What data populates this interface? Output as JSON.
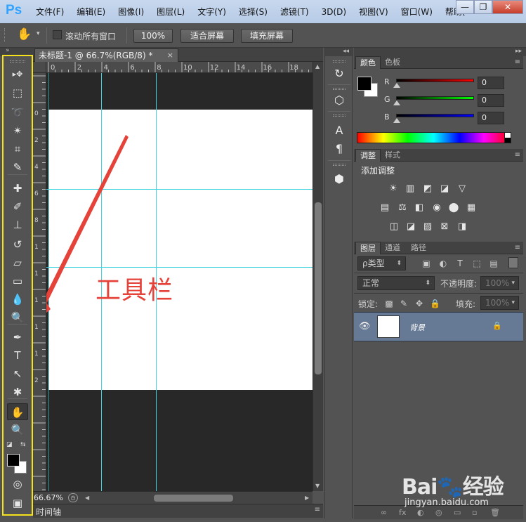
{
  "app": {
    "logo": "Ps",
    "menu": [
      "文件(F)",
      "编辑(E)",
      "图像(I)",
      "图层(L)",
      "文字(Y)",
      "选择(S)",
      "滤镜(T)",
      "3D(D)",
      "视图(V)",
      "窗口(W)",
      "帮助("
    ],
    "window_controls": {
      "minimize": "—",
      "restore": "❐",
      "close": "✕"
    }
  },
  "options_bar": {
    "tool_icon": "hand-icon",
    "scroll_all_label": "滚动所有窗口",
    "scroll_all_checked": false,
    "zoom_100_label": "100%",
    "fit_screen_label": "适合屏幕",
    "fill_screen_label": "填充屏幕"
  },
  "document": {
    "tab_title": "未标题-1 @ 66.7%(RGB/8) *",
    "tab_close": "×",
    "ruler_h_labels": [
      "0",
      "2",
      "4",
      "6",
      "8",
      "10",
      "12",
      "14",
      "16",
      "18"
    ],
    "ruler_v_labels": [
      "0",
      "2",
      "4",
      "6",
      "8",
      "1",
      "1",
      "1",
      "1",
      "1",
      "2"
    ],
    "annotation_text": "工具栏",
    "annotation_color": "#e5433a",
    "guide_color": "#3fd4e0",
    "zoom_readout": "66.67%",
    "timeline_label": "时间轴"
  },
  "toolbox": {
    "highlight_color": "#f5e21a",
    "tools": [
      {
        "name": "move-tool",
        "glyph": "▸✥"
      },
      {
        "name": "marquee-tool",
        "glyph": "⬚"
      },
      {
        "name": "lasso-tool",
        "glyph": "➰"
      },
      {
        "name": "magic-wand-tool",
        "glyph": "✴"
      },
      {
        "name": "crop-tool",
        "glyph": "⌗"
      },
      {
        "name": "eyedropper-tool",
        "glyph": "✎"
      },
      {
        "name": "healing-brush-tool",
        "glyph": "✚"
      },
      {
        "name": "brush-tool",
        "glyph": "✐"
      },
      {
        "name": "clone-stamp-tool",
        "glyph": "⊥"
      },
      {
        "name": "history-brush-tool",
        "glyph": "↺"
      },
      {
        "name": "eraser-tool",
        "glyph": "▱"
      },
      {
        "name": "gradient-tool",
        "glyph": "▭"
      },
      {
        "name": "blur-tool",
        "glyph": "💧"
      },
      {
        "name": "dodge-tool",
        "glyph": "🔍"
      },
      {
        "name": "pen-tool",
        "glyph": "✒"
      },
      {
        "name": "type-tool",
        "glyph": "T"
      },
      {
        "name": "path-selection-tool",
        "glyph": "↖"
      },
      {
        "name": "shape-tool",
        "glyph": "✱"
      },
      {
        "name": "hand-tool",
        "glyph": "✋"
      },
      {
        "name": "zoom-tool",
        "glyph": "🔍"
      }
    ],
    "quick_mask_glyph": "◎",
    "screen_mode_glyph": "▣"
  },
  "dock_icons": [
    {
      "name": "history-icon",
      "glyph": "↻"
    },
    {
      "name": "3d-icon",
      "glyph": "⬡"
    },
    {
      "name": "character-icon",
      "glyph": "A"
    },
    {
      "name": "paragraph-icon",
      "glyph": "¶"
    },
    {
      "name": "cube-icon",
      "glyph": "⬢"
    }
  ],
  "color_panel": {
    "tabs": [
      "颜色",
      "色板"
    ],
    "channels": [
      {
        "label": "R",
        "value": "0",
        "from": "#000000",
        "to": "#ff0000"
      },
      {
        "label": "G",
        "value": "0",
        "from": "#000000",
        "to": "#00ff00"
      },
      {
        "label": "B",
        "value": "0",
        "from": "#000000",
        "to": "#0000ff"
      }
    ],
    "foreground": "#000000",
    "background": "#ffffff"
  },
  "adjustments_panel": {
    "tabs": [
      "调整",
      "样式"
    ],
    "title": "添加调整",
    "rows": [
      [
        "☀",
        "▥",
        "◩",
        "◪",
        "▽"
      ],
      [
        "▤",
        "⚖",
        "◧",
        "◉",
        "⬤",
        "▦"
      ],
      [
        "◫",
        "◪",
        "▨",
        "⊠",
        "◨"
      ]
    ]
  },
  "layers_panel": {
    "tabs": [
      "图层",
      "通道",
      "路径"
    ],
    "filter_label": "ρ类型",
    "blend_mode": "正常",
    "opacity_label": "不透明度:",
    "opacity_value": "100%",
    "lock_label": "锁定:",
    "fill_label": "填充:",
    "fill_value": "100%",
    "layer_name": "背景",
    "layer_eye": "👁",
    "layer_lock": "🔒",
    "footer_icons": [
      "∞",
      "fx",
      "◐",
      "◎",
      "▭",
      "▫",
      "🗑"
    ]
  },
  "watermark": {
    "logo": "Bai🐾经验",
    "url": "jingyan.baidu.com"
  }
}
